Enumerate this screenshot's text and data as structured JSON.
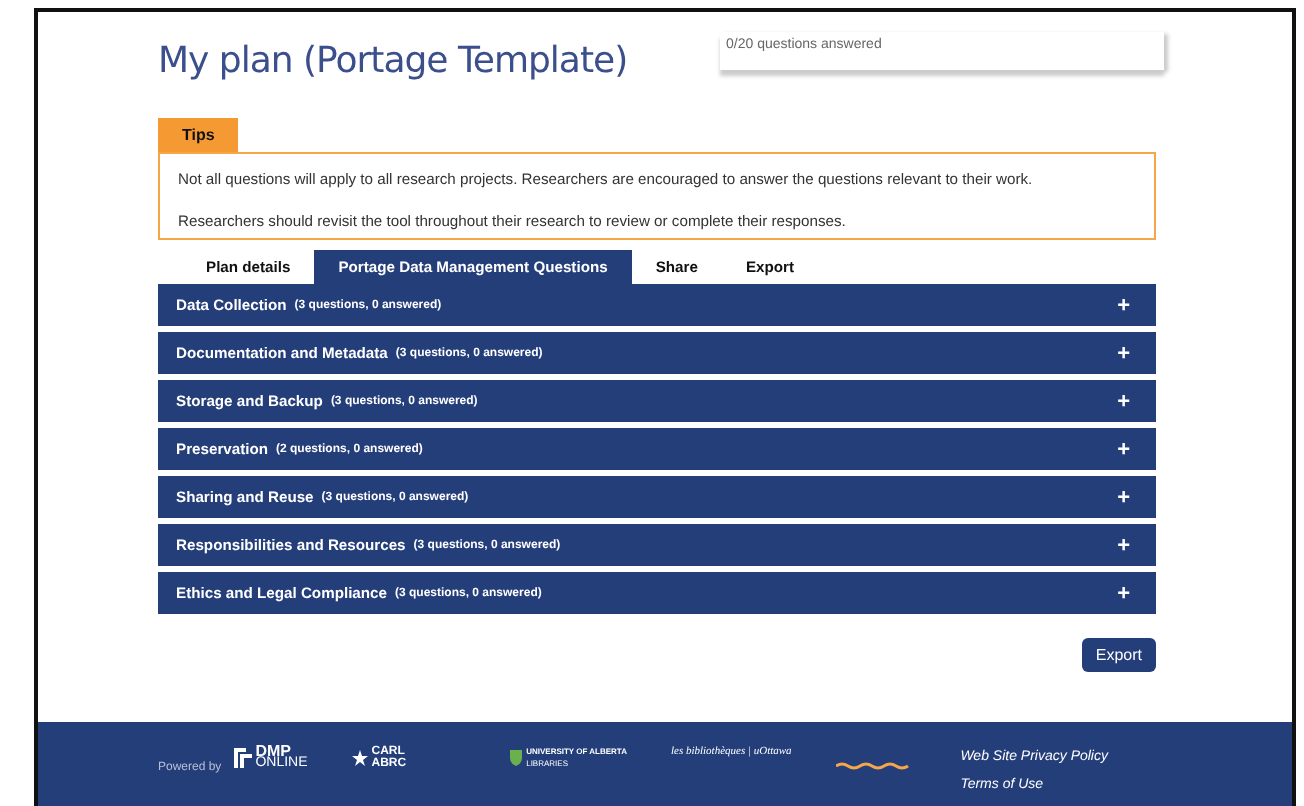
{
  "title": "My plan (Portage Template)",
  "progress": {
    "label": "0/20 questions answered"
  },
  "tips": {
    "label": "Tips",
    "paragraphs": [
      "Not all questions will apply to all research projects. Researchers are encouraged to answer the questions relevant to their work.",
      "Researchers should revisit the tool throughout their research to review or complete their responses."
    ]
  },
  "tabs": [
    {
      "label": "Plan details",
      "selected": false
    },
    {
      "label": "Portage Data Management Questions",
      "selected": true
    },
    {
      "label": "Share",
      "selected": false
    },
    {
      "label": "Export",
      "selected": false
    }
  ],
  "sections": [
    {
      "title": "Data Collection",
      "count": "(3 questions, 0 answered)",
      "toggle": "+"
    },
    {
      "title": "Documentation and Metadata",
      "count": "(3 questions, 0 answered)",
      "toggle": "+"
    },
    {
      "title": "Storage and Backup",
      "count": "(3 questions, 0 answered)",
      "toggle": "+"
    },
    {
      "title": "Preservation",
      "count": "(2 questions, 0 answered)",
      "toggle": "+"
    },
    {
      "title": "Sharing and Reuse",
      "count": "(3 questions, 0 answered)",
      "toggle": "+"
    },
    {
      "title": "Responsibilities and Resources",
      "count": "(3 questions, 0 answered)",
      "toggle": "+"
    },
    {
      "title": "Ethics and Legal Compliance",
      "count": "(3 questions, 0 answered)",
      "toggle": "+"
    }
  ],
  "export_button": "Export",
  "footer": {
    "powered_by": "Powered by",
    "logos": [
      {
        "kind": "dmp",
        "top": "DMP",
        "bottom": "ONLINE"
      },
      {
        "kind": "carl",
        "top": "CARL",
        "bottom": "ABRC"
      },
      {
        "kind": "ualberta",
        "top": "UNIVERSITY OF ALBERTA",
        "bottom": "LIBRARIES"
      },
      {
        "kind": "uottawa",
        "top": "les bibliothèques | uOttawa"
      },
      {
        "kind": "wave"
      }
    ],
    "links": [
      "Web Site Privacy Policy",
      "Terms of Use"
    ]
  }
}
